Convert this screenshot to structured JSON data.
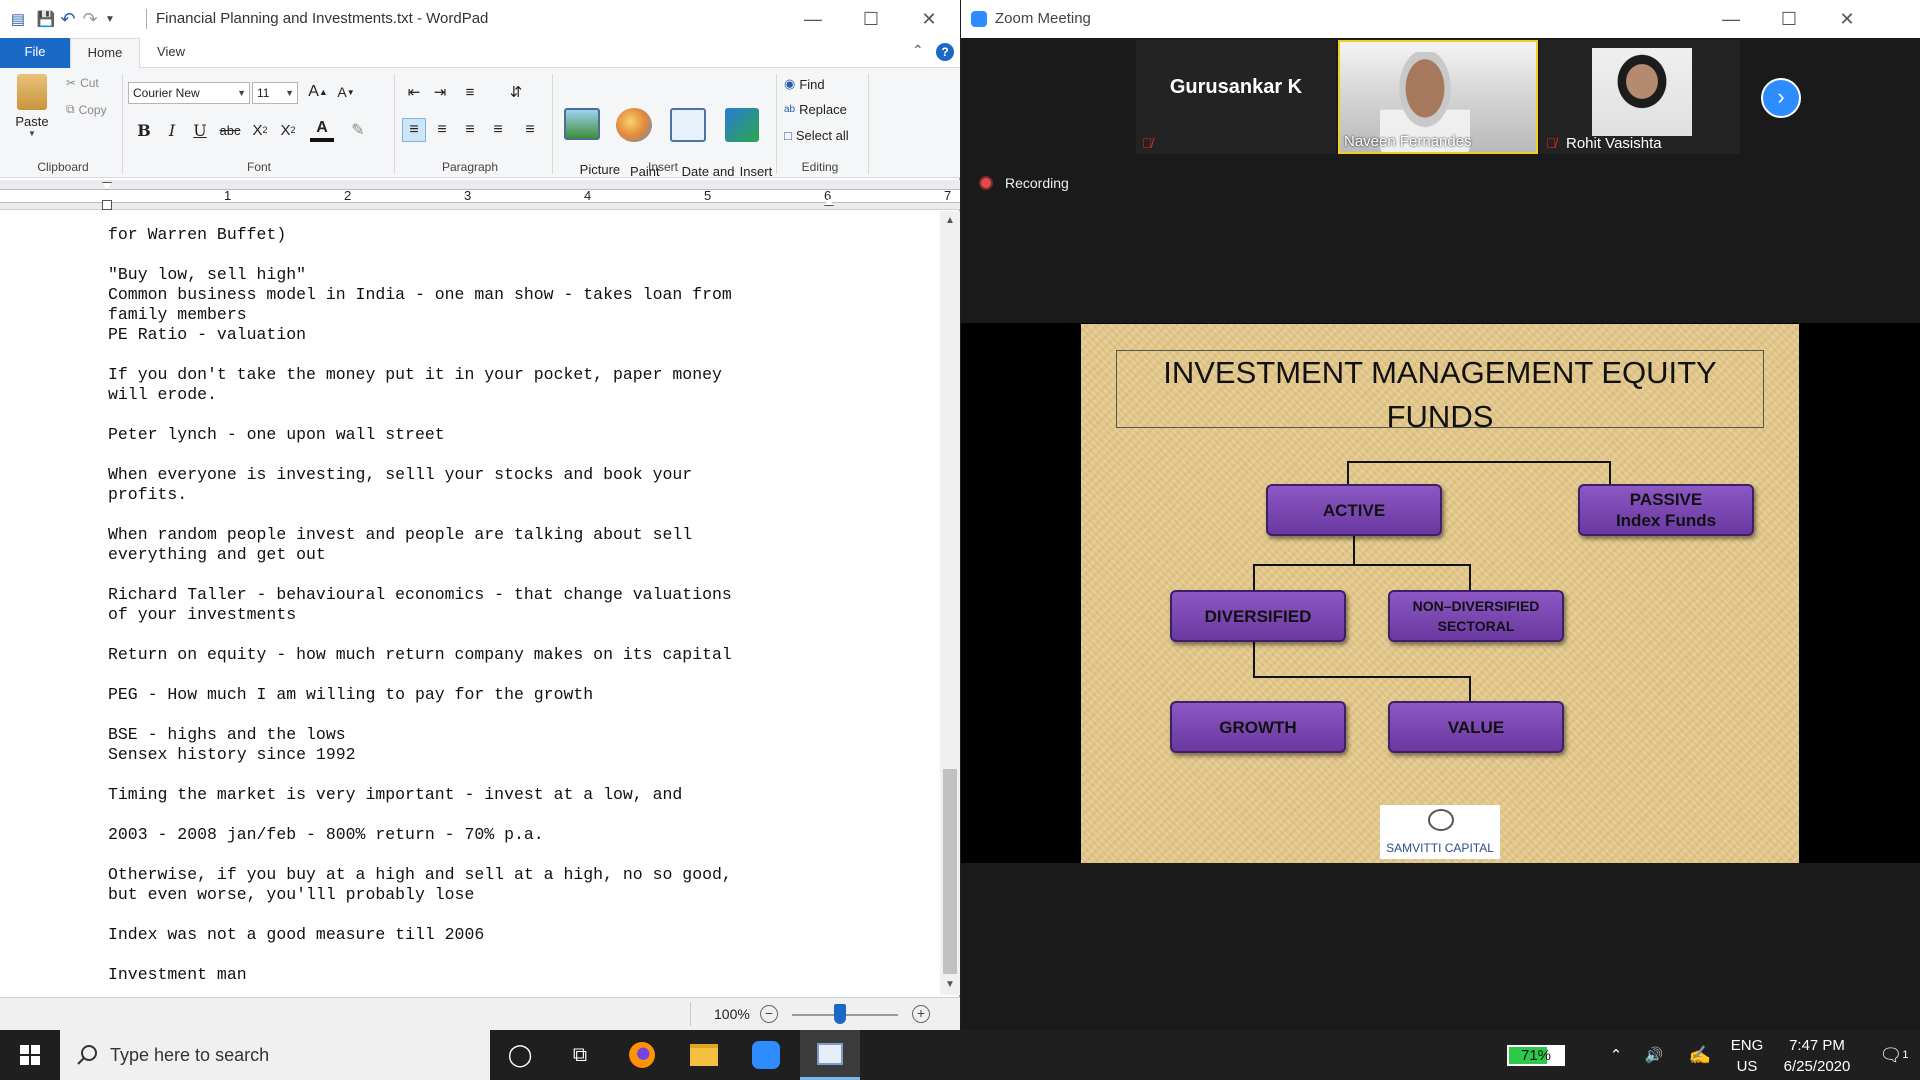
{
  "wordpad": {
    "title": "Financial Planning and Investments.txt - WordPad",
    "tabs": [
      "File",
      "Home",
      "View"
    ],
    "clipboard": {
      "paste": "Paste",
      "cut": "Cut",
      "copy": "Copy",
      "label": "Clipboard"
    },
    "font": {
      "family": "Courier New",
      "size": "11",
      "label": "Font"
    },
    "paragraph": {
      "label": "Paragraph"
    },
    "insert": {
      "picture": "Picture",
      "paint_drawing": "Paint\ndrawing",
      "date_time": "Date and\ntime",
      "insert_object": "Insert\nobject",
      "label": "Insert"
    },
    "editing": {
      "find": "Find",
      "replace": "Replace",
      "select_all": "Select all",
      "label": "Editing"
    },
    "ruler_numbers": [
      "1",
      "2",
      "3",
      "4",
      "5",
      "6",
      "7"
    ],
    "document_text": "for Warren Buffet)\n\n\"Buy low, sell high\"\nCommon business model in India - one man show - takes loan from\nfamily members\nPE Ratio - valuation\n\nIf you don't take the money put it in your pocket, paper money\nwill erode.\n\nPeter lynch - one upon wall street\n\nWhen everyone is investing, selll your stocks and book your\nprofits.\n\nWhen random people invest and people are talking about sell\neverything and get out\n\nRichard Taller - behavioural economics - that change valuations\nof your investments\n\nReturn on equity - how much return company makes on its capital\n\nPEG - How much I am willing to pay for the growth\n\nBSE - highs and the lows\nSensex history since 1992\n\nTiming the market is very important - invest at a low, and\n\n2003 - 2008 jan/feb - 800% return - 70% p.a.\n\nOtherwise, if you buy at a high and sell at a high, no so good,\nbut even worse, you'lll probably lose\n\nIndex was not a good measure till 2006\n\nInvestment man",
    "zoom": "100%",
    "zoom_fraction": 0.45
  },
  "zoom": {
    "title": "Zoom Meeting",
    "participants": [
      {
        "name": "Gurusankar K",
        "muted": true,
        "video": false
      },
      {
        "name": "Naveen Fernandes",
        "muted": false,
        "video": true
      },
      {
        "name": "Rohit Vasishta",
        "muted": true,
        "video": true
      }
    ],
    "recording_label": "Recording",
    "slide": {
      "title": "INVESTMENT MANAGEMENT  EQUITY FUNDS",
      "nodes": {
        "active": "ACTIVE",
        "passive": "PASSIVE\nIndex Funds",
        "diversified": "DIVERSIFIED",
        "non_diversified": "NON–DIVERSIFIED\nSECTORAL",
        "growth": "GROWTH",
        "value": "VALUE"
      },
      "logo_text": "SAMVITTI CAPITAL"
    }
  },
  "taskbar": {
    "search_placeholder": "Type here to search",
    "battery": "71%",
    "battery_level": 0.71,
    "lang_line1": "ENG",
    "lang_line2": "US",
    "time": "7:47 PM",
    "date": "6/25/2020",
    "notification_count": "1"
  },
  "colors": {
    "accent": "#1a69c7",
    "zoom_blue": "#2d8cff",
    "node_purple": "#7c48b4",
    "slide_bg": "#e6ca8c"
  }
}
